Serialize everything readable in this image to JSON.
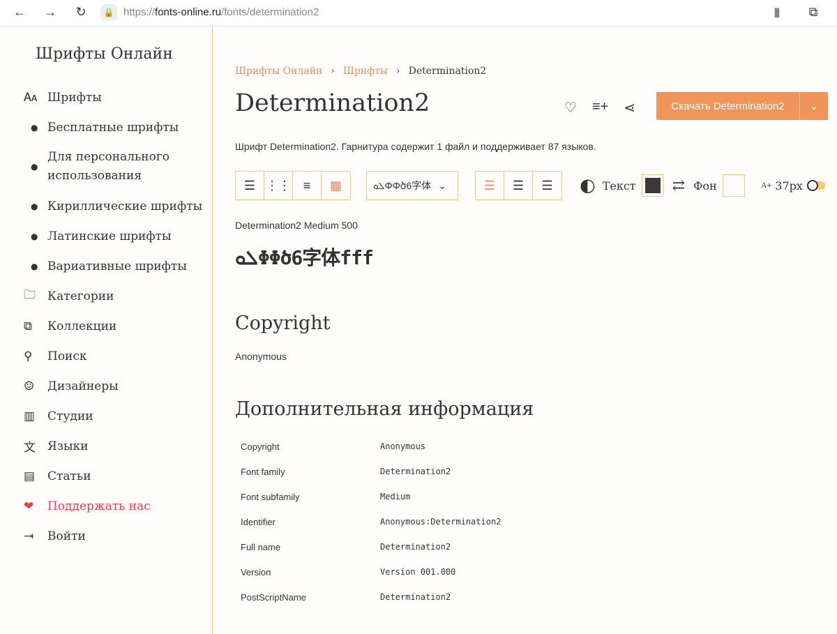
{
  "browser": {
    "url_prefix": "https://",
    "url_host": "fonts-online.ru",
    "url_path": "/fonts/determination2"
  },
  "sidebar": {
    "logo": "Шрифты Онлайн",
    "items": [
      {
        "icon": "font-icon",
        "glyph": "🗛",
        "label": "Шрифты",
        "sub": false
      },
      {
        "icon": "bullet-icon",
        "glyph": "●",
        "label": "Бесплатные шрифты",
        "sub": true
      },
      {
        "icon": "bullet-icon",
        "glyph": "●",
        "label": "Для персонального использования",
        "sub": true
      },
      {
        "icon": "bullet-icon",
        "glyph": "●",
        "label": "Кириллические шрифты",
        "sub": true
      },
      {
        "icon": "bullet-icon",
        "glyph": "●",
        "label": "Латинские шрифты",
        "sub": true
      },
      {
        "icon": "bullet-icon",
        "glyph": "●",
        "label": "Вариативные шрифты",
        "sub": true
      },
      {
        "icon": "folder-icon",
        "glyph": "🗀",
        "label": "Категории",
        "sub": false
      },
      {
        "icon": "collection-icon",
        "glyph": "⧉",
        "label": "Коллекции",
        "sub": false
      },
      {
        "icon": "search-icon",
        "glyph": "⚲",
        "label": "Поиск",
        "sub": false
      },
      {
        "icon": "person-icon",
        "glyph": "☺",
        "label": "Дизайнеры",
        "sub": false
      },
      {
        "icon": "building-icon",
        "glyph": "▥",
        "label": "Студии",
        "sub": false
      },
      {
        "icon": "translate-icon",
        "glyph": "文",
        "label": "Языки",
        "sub": false
      },
      {
        "icon": "articles-icon",
        "glyph": "▤",
        "label": "Статьи",
        "sub": false
      },
      {
        "icon": "heart-icon",
        "glyph": "❤",
        "label": "Поддержать нас",
        "sub": false
      },
      {
        "icon": "login-icon",
        "glyph": "⇥",
        "label": "Войти",
        "sub": false
      }
    ]
  },
  "breadcrumb": [
    "Шрифты Онлайн",
    "Шрифты",
    "Determination2"
  ],
  "title": "Determination2",
  "download_label": "Скачать Determination2",
  "description": "Шрифт Determination2. Гарнитура содержит 1 файл и поддерживает 87 языков.",
  "toolbar": {
    "preview_select": "ܠܘΦΦծ6字体",
    "text_label": "Текст",
    "bg_label": "Фон",
    "size": "37px",
    "text_color": "#3d3935",
    "bg_color": "#ffffff"
  },
  "sample": {
    "label": "Determination2 Medium 500",
    "text": "ܠܘΦΦծ6字体fff"
  },
  "copyright": {
    "heading": "Copyright",
    "value": "Anonymous"
  },
  "info": {
    "heading": "Дополнительная информация",
    "rows": [
      [
        "Copyright",
        "Anonymous"
      ],
      [
        "Font family",
        "Determination2"
      ],
      [
        "Font subfamily",
        "Medium"
      ],
      [
        "Identifier",
        "Anonymous:Determination2"
      ],
      [
        "Full name",
        "Determination2"
      ],
      [
        "Version",
        "Version 001.000"
      ],
      [
        "PostScriptName",
        "Determination2"
      ]
    ]
  }
}
